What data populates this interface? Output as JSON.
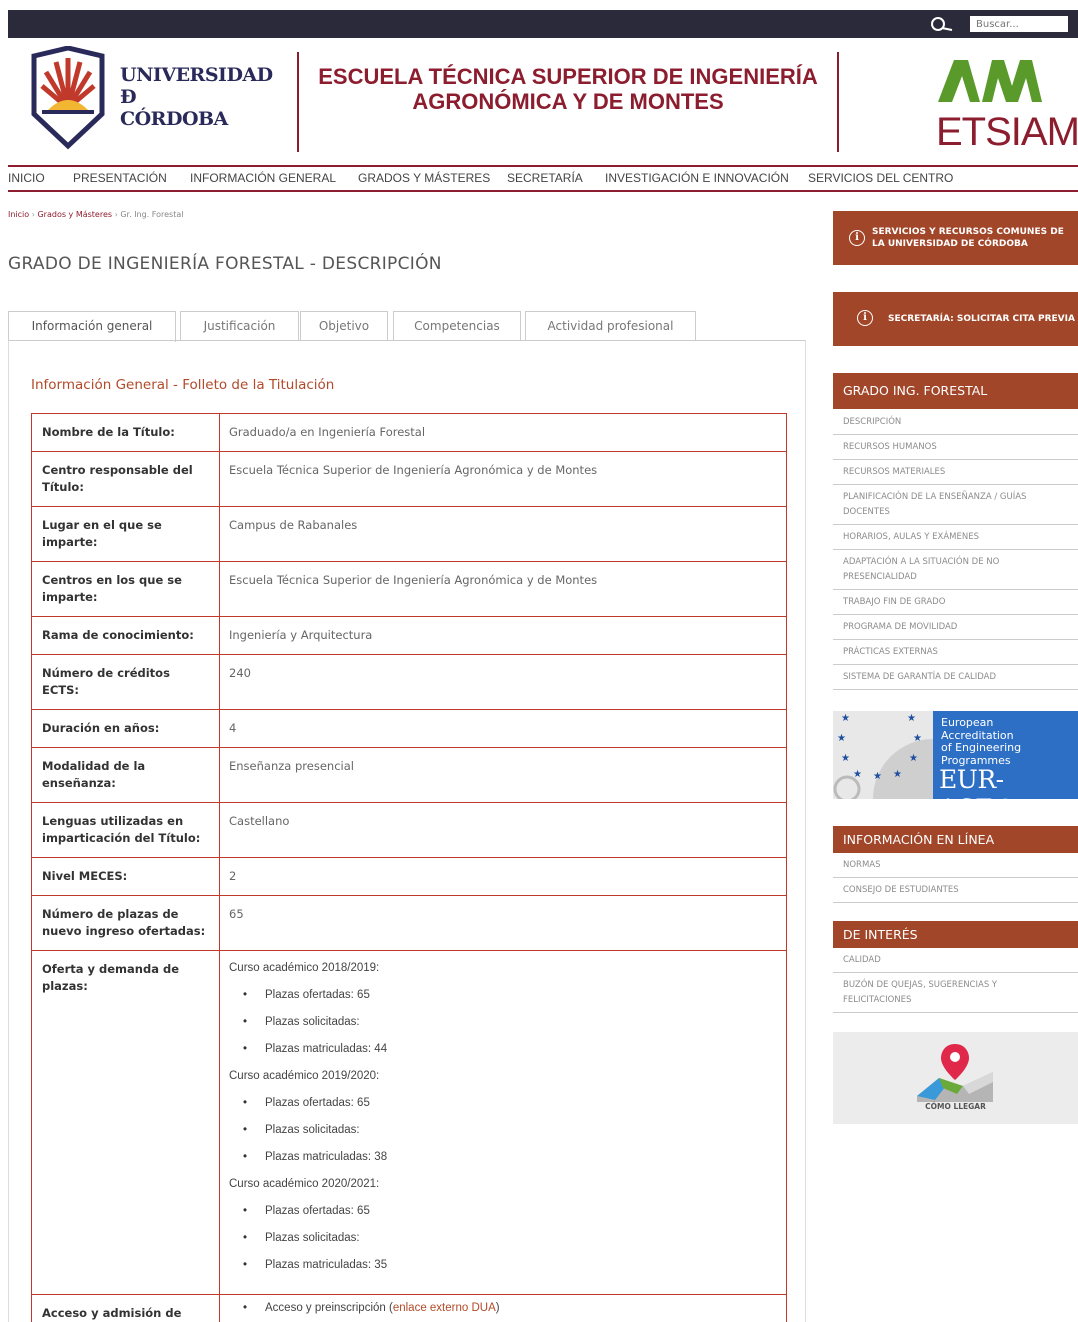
{
  "search": {
    "placeholder": "Buscar..."
  },
  "header": {
    "uco_line1": "UNIVERSIDAD",
    "uco_line2": "Đ",
    "uco_line3": "CÓRDOBA",
    "school_title": "ESCUELA TÉCNICA SUPERIOR DE INGENIERÍA AGRONÓMICA Y DE MONTES",
    "etsiam": "ETSIAM"
  },
  "nav": [
    "INICIO",
    "PRESENTACIÓN",
    "INFORMACIÓN GENERAL",
    "GRADOS Y MÁSTERES",
    "SECRETARÍA",
    "INVESTIGACIÓN E INNOVACIÓN",
    "SERVICIOS DEL CENTRO"
  ],
  "breadcrumb": {
    "home": "Inicio",
    "sep": "›",
    "level2": "Grados y Másteres",
    "current": "Gr. Ing. Forestal"
  },
  "page_title": "GRADO DE INGENIERÍA FORESTAL - DESCRIPCIÓN",
  "tabs": [
    "Información general",
    "Justificación",
    "Objetivo",
    "Competencias",
    "Actividad profesional"
  ],
  "section_title": "Información General - Folleto de la Titulación",
  "rows": [
    {
      "label": "Nombre de la Título:",
      "value": "Graduado/a en Ingeniería Forestal"
    },
    {
      "label": "Centro responsable del Título:",
      "value": "Escuela Técnica Superior de Ingeniería Agronómica y de Montes"
    },
    {
      "label": "Lugar en el que se imparte:",
      "value": "Campus de Rabanales"
    },
    {
      "label": "Centros en los que se imparte:",
      "value": "Escuela Técnica Superior de Ingeniería Agronómica y de Montes"
    },
    {
      "label": "Rama de conocimiento:",
      "value": "Ingeniería y Arquitectura"
    },
    {
      "label": "Número de créditos ECTS:",
      "value": "240"
    },
    {
      "label": "Duración en años:",
      "value": "4"
    },
    {
      "label": "Modalidad de la enseñanza:",
      "value": "Enseñanza presencial"
    },
    {
      "label": "Lenguas utilizadas en imparticación del Título:",
      "value": "Castellano"
    },
    {
      "label": "Nivel MECES:",
      "value": "2"
    },
    {
      "label": "Número de plazas de nuevo ingreso ofertadas:",
      "value": "65"
    }
  ],
  "oferta": {
    "label": "Oferta y demanda de plazas:",
    "years": [
      {
        "curso": "Curso académico 2018/2019:",
        "items": [
          "Plazas ofertadas: 65",
          "Plazas solicitadas:",
          "Plazas matriculadas: 44"
        ]
      },
      {
        "curso": "Curso académico 2019/2020:",
        "items": [
          "Plazas ofertadas: 65",
          "Plazas solicitadas:",
          "Plazas matriculadas: 38"
        ]
      },
      {
        "curso": "Curso académico 2020/2021:",
        "items": [
          "Plazas ofertadas: 65",
          "Plazas solicitadas:",
          "Plazas matriculadas: 35"
        ]
      }
    ]
  },
  "acceso": {
    "label": "Acceso y admisión de",
    "item_text": "Acceso y preinscripción (",
    "item_link": "enlace externo DUA",
    "item_close": ")"
  },
  "sidebar": {
    "btn1": "SERVICIOS Y RECURSOS COMUNES DE LA UNIVERSIDAD DE CÓRDOBA",
    "btn2": "SECRETARÍA: SOLICITAR CITA PREVIA",
    "grado_head": "GRADO ING. FORESTAL",
    "grado_items": [
      "DESCRIPCIÓN",
      "RECURSOS HUMANOS",
      "RECURSOS MATERIALES",
      "PLANIFICACIÓN DE LA ENSEÑANZA / GUÍAS DOCENTES",
      "HORARIOS, AULAS Y EXÁMENES",
      "ADAPTACIÓN A LA SITUACIÓN DE NO PRESENCIALIDAD",
      "TRABAJO FIN DE GRADO",
      "PROGRAMA DE MOVILIDAD",
      "PRÁCTICAS EXTERNAS",
      "SISTEMA DE GARANTÍA DE CALIDAD"
    ],
    "eurace_text": [
      "European",
      "Accreditation",
      "of Engineering",
      "Programmes"
    ],
    "eurace_logo": "EUR-ACE®",
    "online_head": "INFORMACIÓN EN LÍNEA",
    "online_items": [
      "NORMAS",
      "CONSEJO DE ESTUDIANTES"
    ],
    "interes_head": "DE INTERÉS",
    "interes_items": [
      "CALIDAD",
      "BUZÓN DE QUEJAS, SUGERENCIAS Y FELICITACIONES"
    ],
    "como_llegar": "CÓMO LLEGAR"
  },
  "colors": {
    "brand": "#8c1d2e",
    "accent": "#a2462a",
    "table_border": "#c0392b",
    "topbar": "#2a2a3a"
  }
}
